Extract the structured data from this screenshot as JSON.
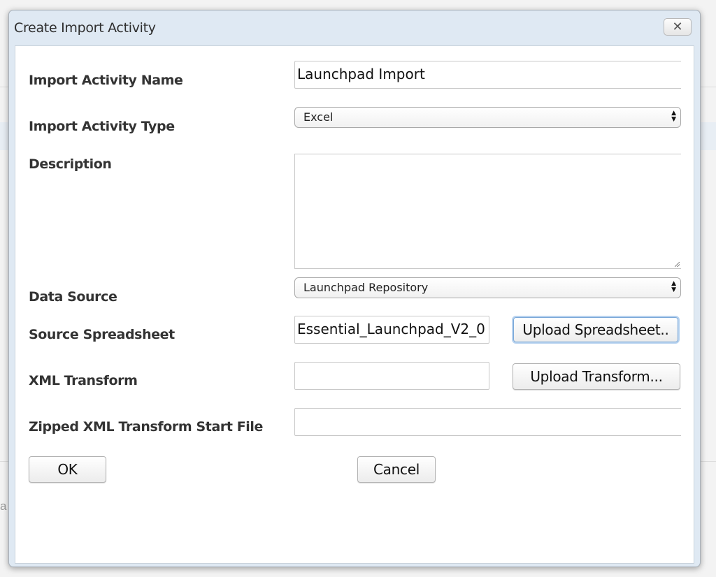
{
  "dialog": {
    "title": "Create Import Activity",
    "close_label": "✕"
  },
  "form": {
    "name": {
      "label": "Import Activity Name",
      "value": "Launchpad Import"
    },
    "type": {
      "label": "Import Activity Type",
      "selected": "Excel"
    },
    "description": {
      "label": "Description",
      "value": ""
    },
    "data_source": {
      "label": "Data Source",
      "selected": "Launchpad Repository"
    },
    "source_spreadsheet": {
      "label": "Source Spreadsheet",
      "value": "Essential_Launchpad_V2_0",
      "button_label": "Upload Spreadsheet.."
    },
    "xml_transform": {
      "label": "XML Transform",
      "value": "",
      "button_label": "Upload Transform..."
    },
    "zipped_start_file": {
      "label": "Zipped XML Transform Start File",
      "value": ""
    }
  },
  "footer": {
    "ok_label": "OK",
    "cancel_label": "Cancel"
  },
  "background": {
    "partial_text": "a"
  }
}
